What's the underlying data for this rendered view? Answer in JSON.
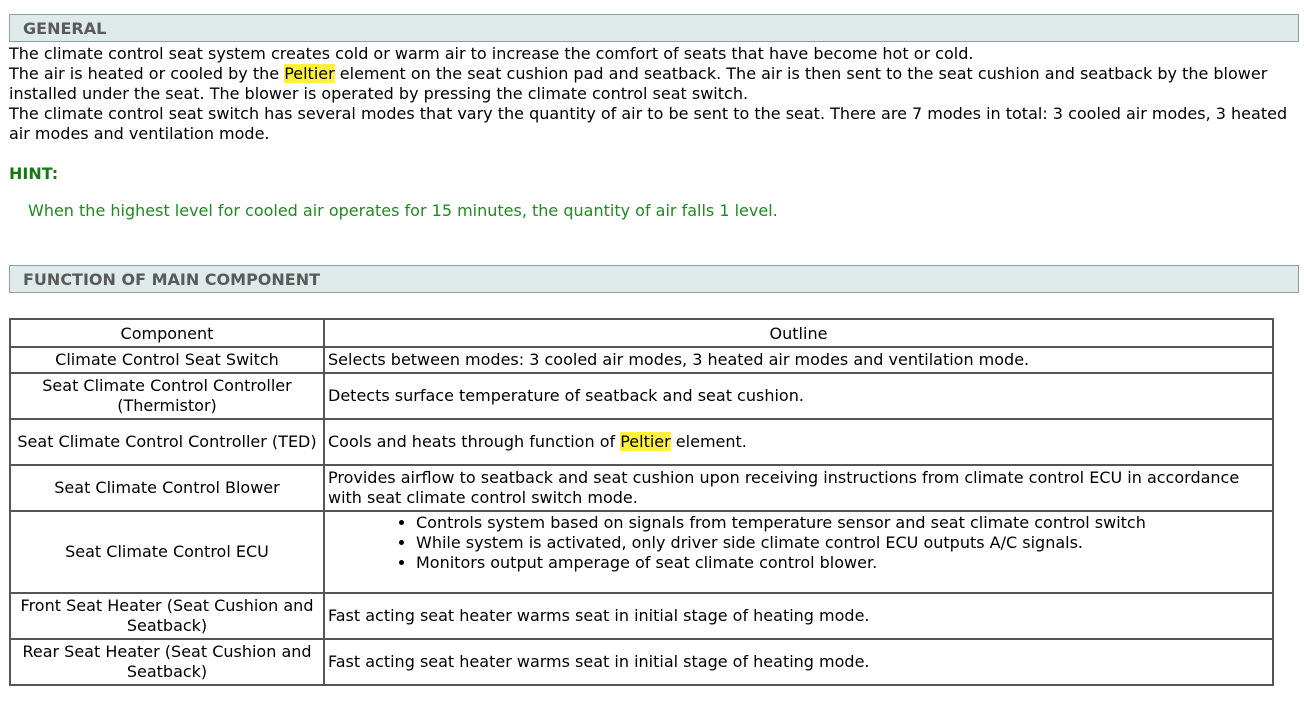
{
  "general": {
    "header": "GENERAL",
    "p1": "The climate control seat system creates cold or warm air to increase the comfort of seats that have become hot or cold.",
    "p2_before": "The air is heated or cooled by the ",
    "p2_highlight": "Peltier",
    "p2_after": " element on the seat cushion pad and seatback. The air is then sent to the seat cushion and seatback by the blower installed under the seat. The blower is operated by pressing the climate control seat switch.",
    "p3": "The climate control seat switch has several modes that vary the quantity of air to be sent to the seat. There are 7 modes in total: 3 cooled air modes, 3 heated air modes and ventilation mode."
  },
  "hint": {
    "label": "HINT:",
    "text": "When the highest level for cooled air operates for 15 minutes, the quantity of air falls 1 level."
  },
  "function": {
    "header": "FUNCTION OF MAIN COMPONENT",
    "columns": [
      "Component",
      "Outline"
    ],
    "rows": [
      {
        "component": "Climate Control Seat Switch",
        "outline": "Selects between modes: 3 cooled air modes, 3 heated air modes and ventilation mode."
      },
      {
        "component": "Seat Climate Control Controller (Thermistor)",
        "outline": "Detects surface temperature of seatback and seat cushion."
      },
      {
        "component": "Seat Climate Control Controller (TED)",
        "outline_before": "Cools and heats through function of ",
        "outline_highlight": "Peltier",
        "outline_after": " element."
      },
      {
        "component": "Seat Climate Control Blower",
        "outline": "Provides airflow to seatback and seat cushion upon receiving instructions from climate control ECU in accordance with seat climate control switch mode."
      },
      {
        "component": "Seat Climate Control ECU",
        "bullets": [
          "Controls system based on signals from temperature sensor and seat climate control switch",
          "While system is activated, only driver side climate control ECU outputs A/C signals.",
          "Monitors output amperage of seat climate control blower."
        ]
      },
      {
        "component": "Front Seat Heater (Seat Cushion and Seatback)",
        "outline": "Fast acting seat heater warms seat in initial stage of heating mode."
      },
      {
        "component": "Rear Seat Heater (Seat Cushion and Seatback)",
        "outline": "Fast acting seat heater warms seat in initial stage of heating mode."
      }
    ]
  },
  "colors": {
    "header_bg": "#dfeaea",
    "header_text": "#5a5a5a",
    "hint": "#137a13",
    "highlight": "#fff23a"
  }
}
